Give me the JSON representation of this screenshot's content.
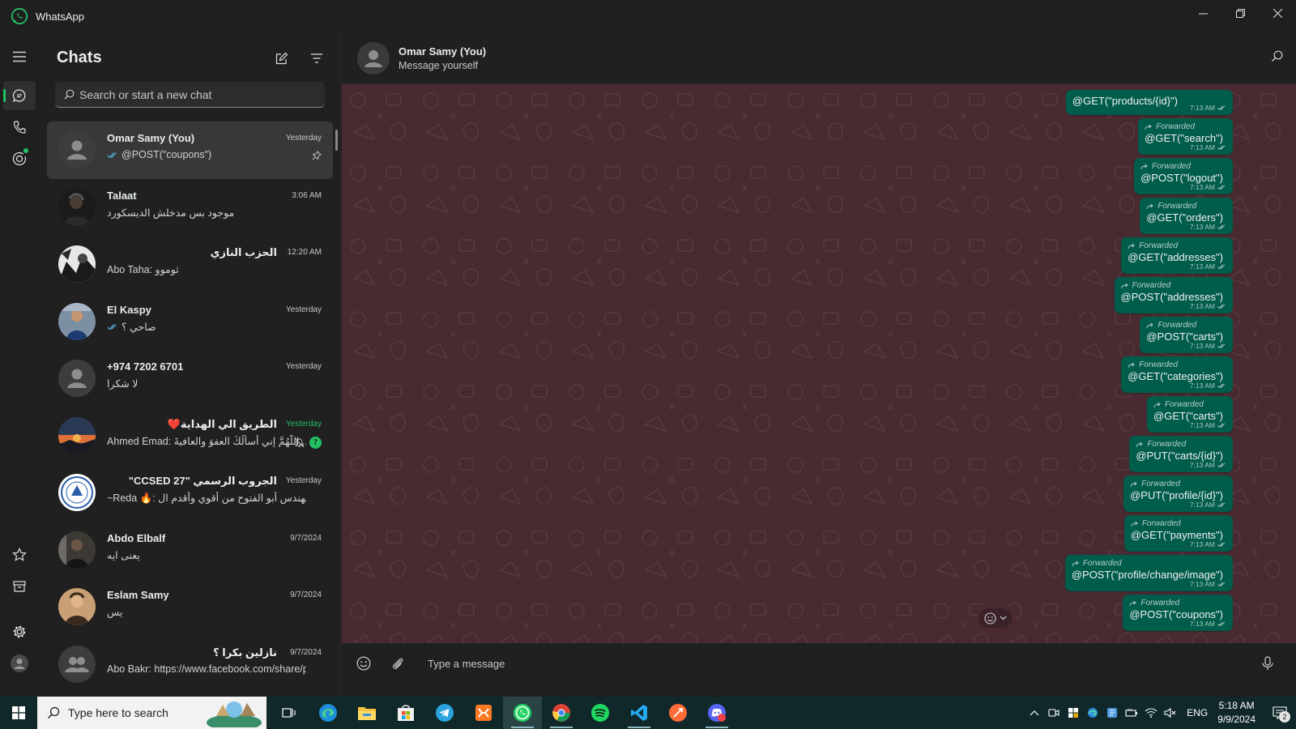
{
  "window": {
    "title": "WhatsApp"
  },
  "chat_list": {
    "title": "Chats",
    "search_placeholder": "Search or start a new chat",
    "chats": [
      {
        "name": "Omar Samy (You)",
        "time": "Yesterday",
        "preview": "@POST(\"coupons\")",
        "ticks": true,
        "pinned": true,
        "selected": true,
        "avatar": "default-person"
      },
      {
        "name": "Talaat",
        "time": "3:06 AM",
        "preview": "موجود بس مدخلش الديسكورد",
        "avatar": "photo-dark"
      },
      {
        "name": "الحزب النازي",
        "time": "12:20 AM",
        "preview": "Abo Taha: ثوموو",
        "avatar": "photo-bw"
      },
      {
        "name": "El Kaspy",
        "time": "Yesterday",
        "preview": "صاحي ؟",
        "ticks": true,
        "avatar": "photo-blue"
      },
      {
        "name": "+974 7202 6701",
        "time": "Yesterday",
        "preview": "لا شكرا",
        "avatar": "default-person"
      },
      {
        "name": "الطريق الي الهداية❤️",
        "time": "Yesterday",
        "time_green": true,
        "preview": "Ahmed Emad: اللَّهُمَّ إني أسألُكَ العفوَ والعافيةَ...",
        "muted": true,
        "unread": "7",
        "avatar": "photo-sunset"
      },
      {
        "name": "الجروب الرسمي  \"CCSED 27\"",
        "time": "Yesterday",
        "preview": "~Reda 🔥: بشمهندس أبو الفتوح من أقوي وأقدم ال...",
        "avatar": "photo-seal"
      },
      {
        "name": "Abdo Elbalf",
        "time": "9/7/2024",
        "preview": "يعنى ايه",
        "avatar": "photo-dark2"
      },
      {
        "name": "Eslam Samy",
        "time": "9/7/2024",
        "preview": "يس",
        "avatar": "photo-warm"
      },
      {
        "name": "نازلين بكرا ؟",
        "time": "9/7/2024",
        "preview": "Abo Bakr: https://www.facebook.com/share/p/...",
        "avatar": "default-group"
      }
    ]
  },
  "conversation": {
    "title": "Omar Samy (You)",
    "subtitle": "Message yourself",
    "forwarded_label": "Forwarded",
    "messages": [
      {
        "text": "@GET(\"products/{id}\")",
        "time": "7:13 AM",
        "forwarded": false,
        "partial": true
      },
      {
        "text": "@GET(\"search\")",
        "time": "7:13 AM",
        "forwarded": true
      },
      {
        "text": "@POST(\"logout\")",
        "time": "7:13 AM",
        "forwarded": true
      },
      {
        "text": "@GET(\"orders\")",
        "time": "7:13 AM",
        "forwarded": true
      },
      {
        "text": "@GET(\"addresses\")",
        "time": "7:13 AM",
        "forwarded": true
      },
      {
        "text": "@POST(\"addresses\")",
        "time": "7:13 AM",
        "forwarded": true
      },
      {
        "text": "@POST(\"carts\")",
        "time": "7:13 AM",
        "forwarded": true
      },
      {
        "text": "@GET(\"categories\")",
        "time": "7:13 AM",
        "forwarded": true
      },
      {
        "text": "@GET(\"carts\")",
        "time": "7:13 AM",
        "forwarded": true
      },
      {
        "text": "@PUT(\"carts/{id}\")",
        "time": "7:13 AM",
        "forwarded": true
      },
      {
        "text": "@PUT(\"profile/{id}\")",
        "time": "7:13 AM",
        "forwarded": true
      },
      {
        "text": "@GET(\"payments\")",
        "time": "7:13 AM",
        "forwarded": true
      },
      {
        "text": "@POST(\"profile/change/image\")",
        "time": "7:13 AM",
        "forwarded": true
      },
      {
        "text": "@POST(\"coupons\")",
        "time": "7:13 AM",
        "forwarded": true
      }
    ],
    "composer_placeholder": "Type a message"
  },
  "taskbar": {
    "search_placeholder": "Type here to search",
    "apps": [
      "task-view",
      "edge",
      "file-explorer",
      "microsoft-store",
      "telegram",
      "xampp",
      "whatsapp",
      "chrome",
      "spotify",
      "vscode",
      "postman",
      "discord"
    ],
    "language": "ENG",
    "time": "5:18 AM",
    "date": "9/9/2024",
    "notifications": "2"
  },
  "colors": {
    "accent": "#21c063",
    "bubble": "#005c4b",
    "chat_background": "#4a2a31",
    "panel": "#202020",
    "taskbar": "#10282a"
  }
}
